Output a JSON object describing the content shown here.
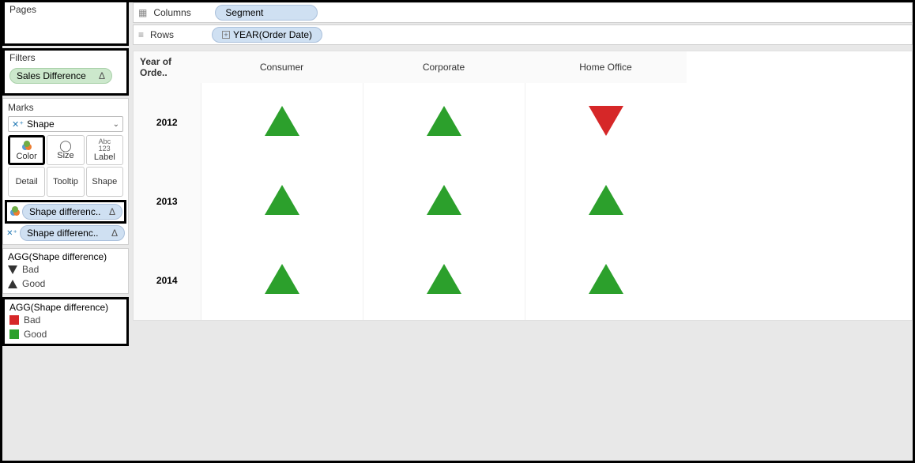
{
  "left": {
    "pages_title": "Pages",
    "filters_title": "Filters",
    "filter_pill": "Sales Difference",
    "delta_symbol": "Δ",
    "marks_title": "Marks",
    "mark_type": "Shape",
    "mark_cells": {
      "color": "Color",
      "size": "Size",
      "label": "Label",
      "detail": "Detail",
      "tooltip": "Tooltip",
      "shape": "Shape"
    },
    "shelf_pill1": "Shape differenc..",
    "shelf_pill2": "Shape differenc..",
    "legend1_title": "AGG(Shape difference)",
    "legend1_bad": "Bad",
    "legend1_good": "Good",
    "legend2_title": "AGG(Shape difference)",
    "legend2_bad": "Bad",
    "legend2_good": "Good"
  },
  "shelves": {
    "columns_label": "Columns",
    "columns_pill": "Segment",
    "rows_label": "Rows",
    "rows_pill": "YEAR(Order Date)"
  },
  "viz": {
    "row_axis_title": "Year of Orde..",
    "cols": [
      "Consumer",
      "Corporate",
      "Home Office"
    ],
    "rows": [
      "2012",
      "2013",
      "2014"
    ]
  },
  "chart_data": {
    "type": "table",
    "row_field": "Year of Order Date",
    "col_field": "Segment",
    "shape_encoding": {
      "Good": "triangle-up",
      "Bad": "triangle-down"
    },
    "color_encoding": {
      "Good": "#2ca02c",
      "Bad": "#d62728"
    },
    "columns": [
      "Consumer",
      "Corporate",
      "Home Office"
    ],
    "rows": [
      "2012",
      "2013",
      "2014"
    ],
    "values": [
      [
        "Good",
        "Good",
        "Bad"
      ],
      [
        "Good",
        "Good",
        "Good"
      ],
      [
        "Good",
        "Good",
        "Good"
      ]
    ]
  }
}
